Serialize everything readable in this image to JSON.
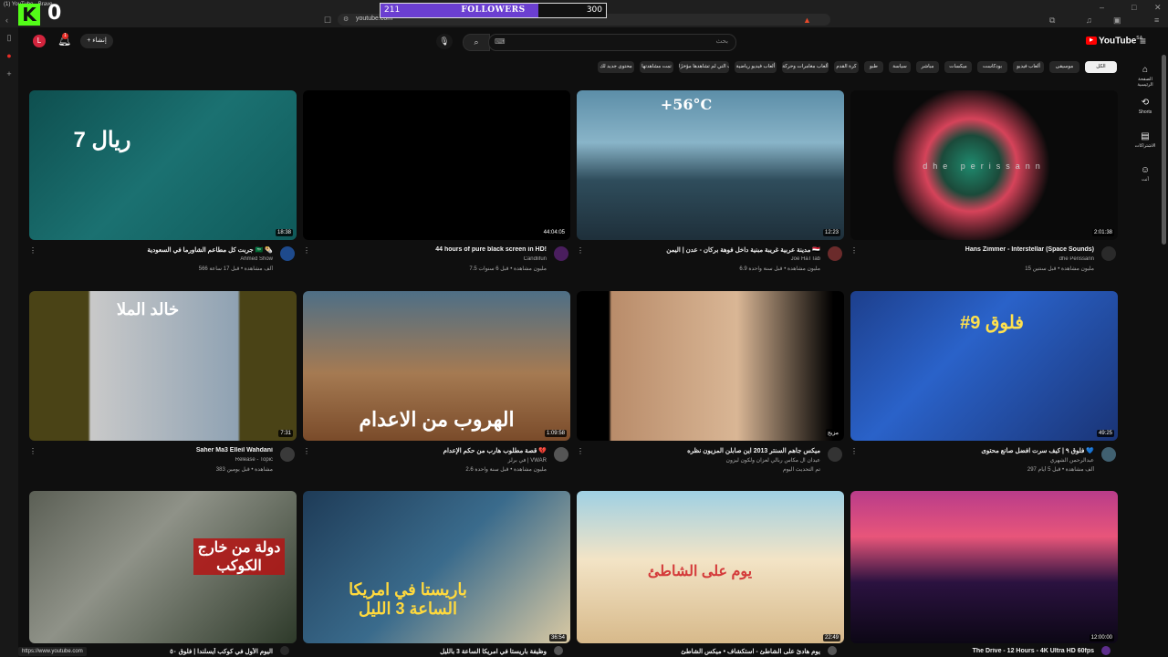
{
  "browser": {
    "tab_title": "(1) YouTube - Brave",
    "url": "youtube.com",
    "status_url": "https://www.youtube.com"
  },
  "overlay": {
    "followers_start": "211",
    "followers_label": "FOLLOWERS",
    "followers_goal": "300",
    "followers_progress": 0.7,
    "kick_logo": "K",
    "kick_count": "0"
  },
  "header": {
    "avatar_letter": "L",
    "notification_badge": "1",
    "create_label": "إنشاء",
    "search_placeholder": "بحث",
    "logo_text": "YouTube",
    "logo_region": "SA"
  },
  "chips": [
    {
      "label": "الكل",
      "active": true
    },
    {
      "label": "موسيقى",
      "active": false
    },
    {
      "label": "ألعاب فيديو",
      "active": false
    },
    {
      "label": "بودكاست",
      "active": false
    },
    {
      "label": "ميكسات",
      "active": false
    },
    {
      "label": "مباشر",
      "active": false
    },
    {
      "label": "سياسة",
      "active": false
    },
    {
      "label": "طبو",
      "active": false
    },
    {
      "label": "كرة القدم",
      "active": false
    },
    {
      "label": "ألعاب مغامرات وحركة",
      "active": false
    },
    {
      "label": "ألعاب فيديو رياضية",
      "active": false
    },
    {
      "label": "الفيديوهات التي لم تشاهدها مؤخرًا",
      "active": false
    },
    {
      "label": "تمت مشاهدتها",
      "active": false
    },
    {
      "label": "محتوى جديد لك",
      "active": false
    }
  ],
  "right_nav": [
    {
      "label": "الصفحة الرئيسية",
      "icon": "home-icon"
    },
    {
      "label": "Shorts",
      "icon": "shorts-icon"
    },
    {
      "label": "الاشتراكات",
      "icon": "subscriptions-icon"
    },
    {
      "label": "أنت",
      "icon": "you-icon"
    }
  ],
  "videos": [
    {
      "title": "Hans Zimmer - Interstellar (Space Sounds)",
      "channel": "dhe Perissann",
      "meta": "15 مليون مشاهدة • قبل سنتين",
      "duration": "2:01:38",
      "thumb_text": "dhe perissann"
    },
    {
      "title": "مدينة عربية غريبة مبنية داخل فوهة بركان - عدن | اليمن 🇾🇪",
      "channel": "Joe HaTTab",
      "meta": "6.9 مليون مشاهدة • قبل سنة واحدة",
      "duration": "12:23",
      "thumb_text": "+56°C"
    },
    {
      "title": "44 hours of pure black screen in HD!",
      "channel": "Candlifun",
      "meta": "7.5 مليون مشاهدة • قبل 6 سنوات",
      "duration": "44:04:05",
      "thumb_text": ""
    },
    {
      "title": "جربت كل مطاعم الشاورما في السعودية 🇸🇦 🌯",
      "channel": "Ahmed Show",
      "meta": "566 ألف مشاهدة • قبل 17 ساعة",
      "duration": "18:38",
      "thumb_text": "7 ريال"
    },
    {
      "title": "فلوق ٩ | كيف سرت افضل صانع محتوى 💙",
      "channel": "عبدالرحمن الشهري",
      "meta": "297 ألف مشاهدة • قبل 5 أيام",
      "duration": "49:25",
      "thumb_text": "#9 فلوق"
    },
    {
      "title": "ميكس جاهم السنتر 2013 اين صابلن المزيون نظره",
      "channel": "عيدان ال مكاس ربالي لعزان ولكون ليزون",
      "meta": "تم التحديث اليوم",
      "duration": "مزيج",
      "thumb_text": ""
    },
    {
      "title": "قصة مطلوب هارب من حكم الإعدام 💔",
      "channel": "في برلز | VWAR",
      "meta": "2.6 مليون مشاهدة • قبل سنة واحدة",
      "duration": "1:09:58",
      "thumb_text": "الهروب من الاعدام"
    },
    {
      "title": "Saher Ma3 Elleil Wahdani",
      "channel": "Release - Topic",
      "meta": "383 مشاهدة • قبل يومين",
      "duration": "7:31",
      "thumb_text": "خالد الملا"
    },
    {
      "title": "The Drive - 12 Hours - 4K Ultra HD 60fps",
      "channel": "",
      "meta": "",
      "duration": "12:00:00",
      "thumb_text": ""
    },
    {
      "title": "يوم هادئ على الشاطئ - استكشاف • ميكس الشاطئ",
      "channel": "",
      "meta": "",
      "duration": "22:49",
      "thumb_text": "يوم على الشاطئ"
    },
    {
      "title": "وظيفة باريستا في امريكا الساعة 3 بالليل",
      "channel": "",
      "meta": "",
      "duration": "36:54",
      "thumb_text": "باريستا في امريكا الساعة 3 الليل"
    },
    {
      "title": "اليوم الأول في كوكب آيسلندا | فلوق ٥٠",
      "channel": "",
      "meta": "",
      "duration": "",
      "thumb_text": "دولة من خارج الكوكب"
    }
  ]
}
